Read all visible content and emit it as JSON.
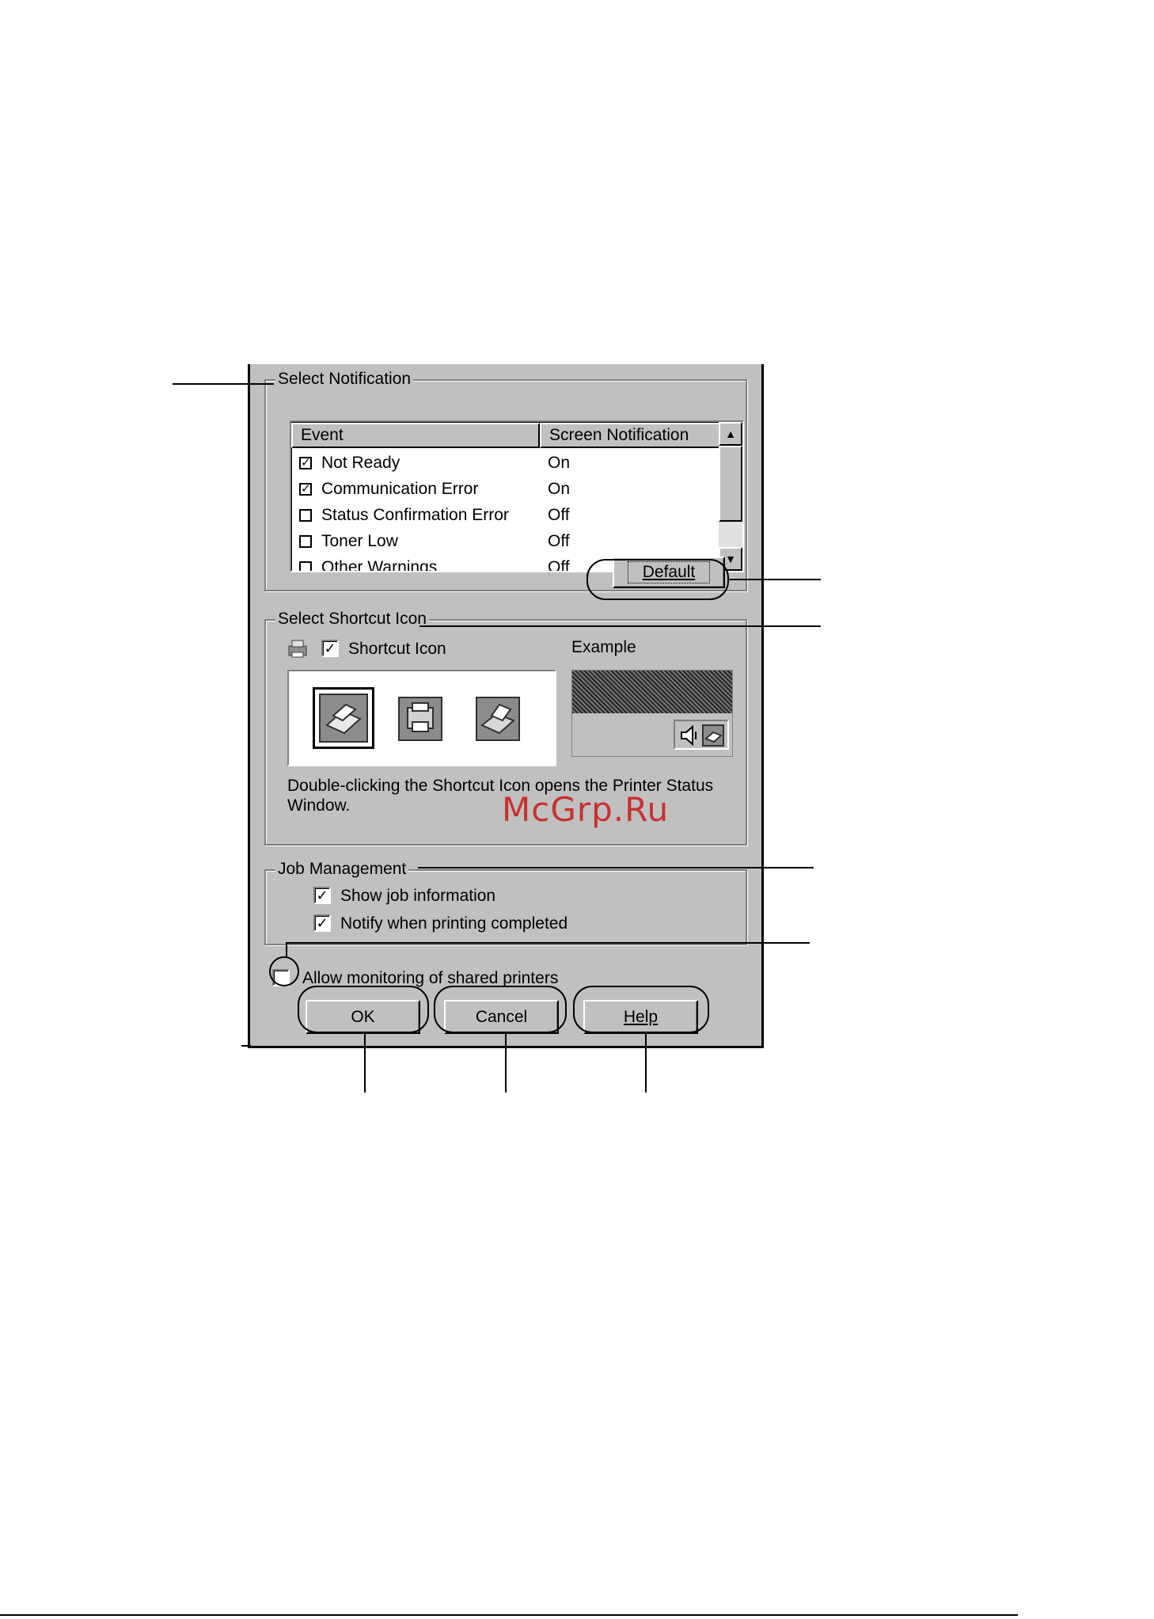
{
  "select_notification": {
    "legend": "Select Notification",
    "columns": [
      "Event",
      "Screen Notification"
    ],
    "rows": [
      {
        "event": "Not Ready",
        "checked": true,
        "notification": "On"
      },
      {
        "event": "Communication Error",
        "checked": true,
        "notification": "On"
      },
      {
        "event": "Status Confirmation Error",
        "checked": false,
        "notification": "Off"
      },
      {
        "event": "Toner Low",
        "checked": false,
        "notification": "Off"
      },
      {
        "event": "Other Warnings",
        "checked": false,
        "notification": "Off"
      }
    ],
    "default_button": "Default"
  },
  "select_shortcut_icon": {
    "legend": "Select Shortcut Icon",
    "checkbox_label": "Shortcut Icon",
    "checked": true,
    "example_label": "Example",
    "description": "Double-clicking the Shortcut Icon opens the Printer Status Window."
  },
  "job_management": {
    "legend": "Job Management",
    "show_job_info": "Show job information",
    "show_job_info_checked": true,
    "notify_completed": "Notify when printing completed",
    "notify_completed_checked": true
  },
  "allow_monitoring": {
    "label": "Allow monitoring of shared printers",
    "checked": false
  },
  "buttons": {
    "ok": "OK",
    "cancel": "Cancel",
    "help": "Help"
  },
  "watermark": "McGrp.Ru",
  "colors": {
    "dialog_bg": "#c0c0c0",
    "watermark": "#cc0000"
  }
}
